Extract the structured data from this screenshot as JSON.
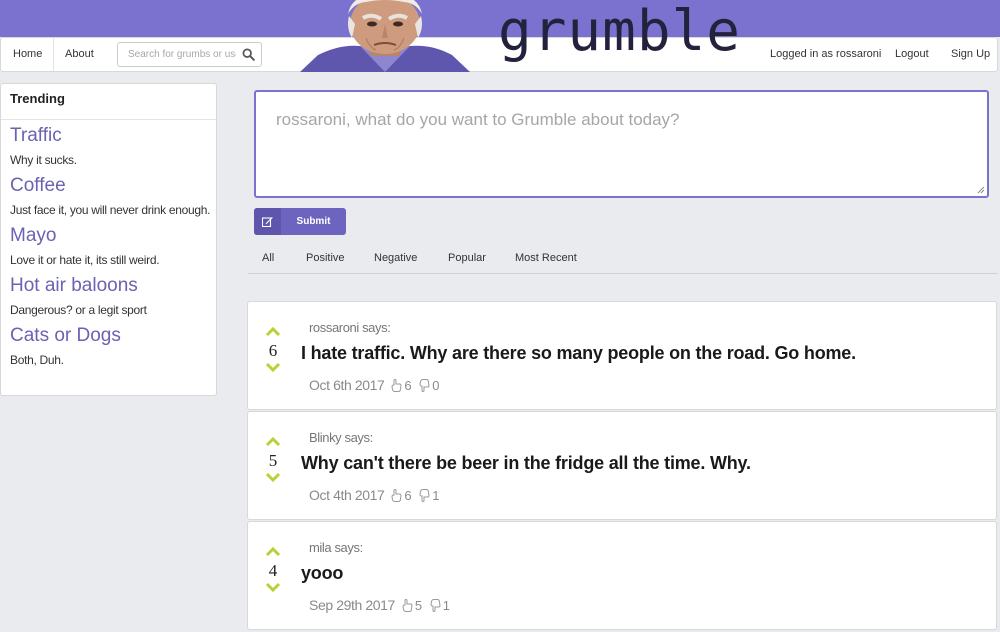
{
  "nav": {
    "home": "Home",
    "about": "About",
    "search_placeholder": "Search for grumbs or users",
    "logged_in": "Logged in as rossaroni",
    "logout": "Logout",
    "signup": "Sign Up"
  },
  "brand": {
    "logo": "grumble"
  },
  "sidebar": {
    "heading": "Trending",
    "items": [
      {
        "title": "Traffic",
        "desc": "Why it sucks."
      },
      {
        "title": "Coffee",
        "desc": "Just face it, you will never drink enough."
      },
      {
        "title": "Mayo",
        "desc": "Love it or hate it, its still weird."
      },
      {
        "title": "Hot air baloons",
        "desc": "Dangerous? or a legit sport"
      },
      {
        "title": "Cats or Dogs",
        "desc": "Both, Duh."
      }
    ]
  },
  "compose": {
    "placeholder": "rossaroni, what do you want to Grumble about today?",
    "submit": "Submit"
  },
  "tabs": [
    "All",
    "Positive",
    "Negative",
    "Popular",
    "Most Recent"
  ],
  "posts": [
    {
      "author": "rossaroni says:",
      "text": "I hate traffic. Why are there so many people on the road. Go home.",
      "score": "6",
      "date": "Oct 6th 2017",
      "likes": "6",
      "dislikes": "0"
    },
    {
      "author": "Blinky says:",
      "text": "Why can't there be beer in the fridge all the time. Why.",
      "score": "5",
      "date": "Oct 4th 2017",
      "likes": "6",
      "dislikes": "1"
    },
    {
      "author": "mila says:",
      "text": "yooo",
      "score": "4",
      "date": "Sep 29th 2017",
      "likes": "5",
      "dislikes": "1"
    }
  ],
  "colors": {
    "brand": "#7b72d0",
    "link": "#6a62b2",
    "vote": "#b5d334",
    "button": "#6d64c0"
  },
  "icons": {
    "search": "search-icon",
    "submit": "edit-icon",
    "vote_up": "chevron-up-icon",
    "vote_down": "chevron-down-icon",
    "like": "thumbs-up-icon",
    "dislike": "thumbs-down-icon"
  }
}
